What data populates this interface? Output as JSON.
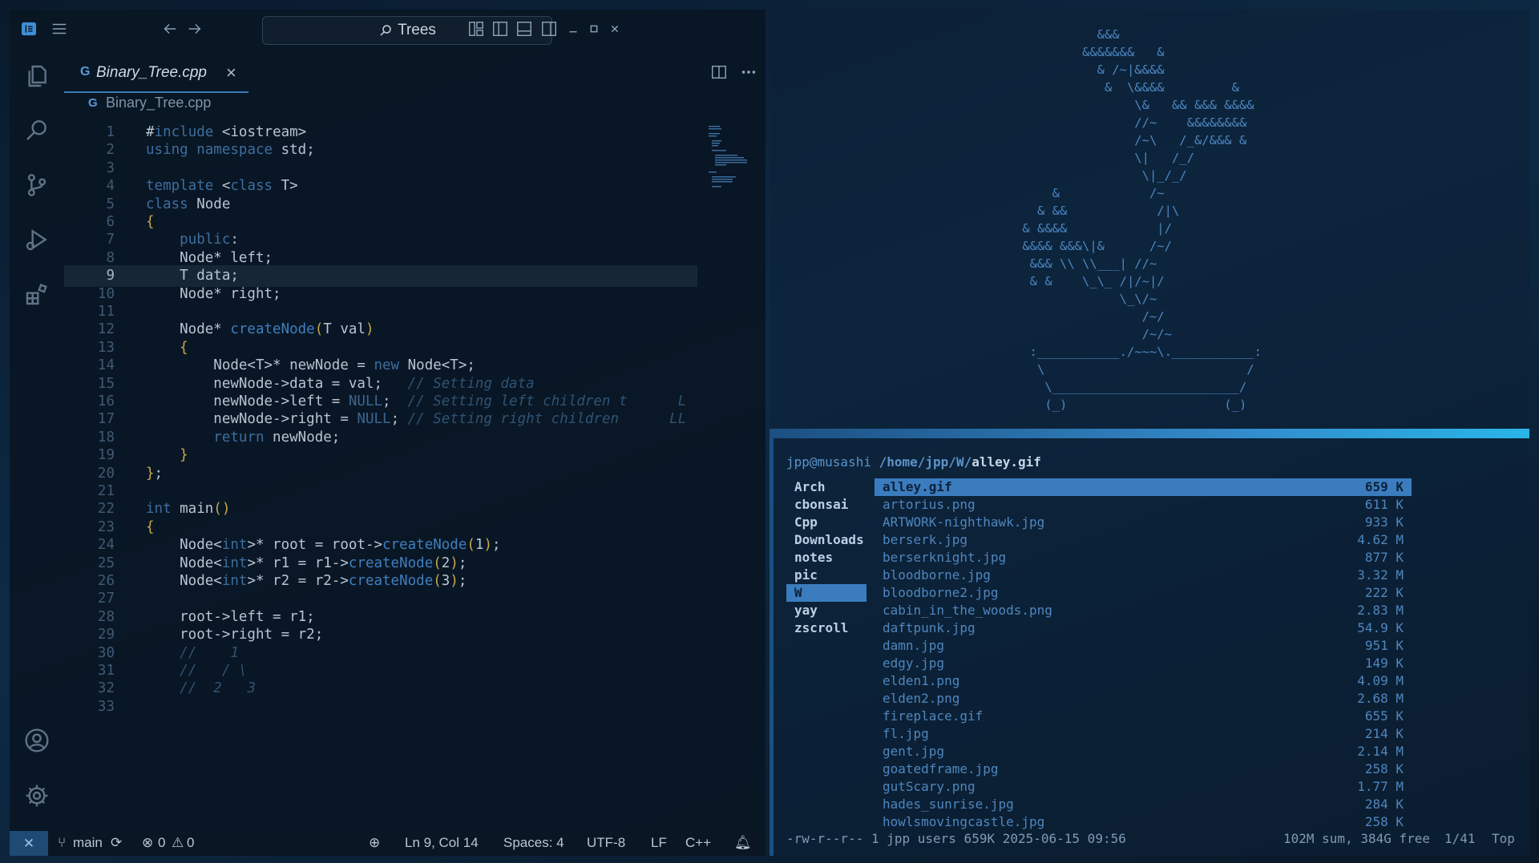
{
  "titlebar": {
    "search_label": "Trees"
  },
  "tab": {
    "label": "Binary_Tree.cpp",
    "close": "×"
  },
  "breadcrumb": {
    "file": "Binary_Tree.cpp"
  },
  "code_lines": [
    {
      "n": "1",
      "code": "#include <iostream>"
    },
    {
      "n": "2",
      "code": "using namespace std;"
    },
    {
      "n": "3",
      "code": ""
    },
    {
      "n": "4",
      "code": "template <class T>"
    },
    {
      "n": "5",
      "code": "class Node"
    },
    {
      "n": "6",
      "code": "{"
    },
    {
      "n": "7",
      "code": "    public:"
    },
    {
      "n": "8",
      "code": "    Node* left;"
    },
    {
      "n": "9",
      "code": "    T data;"
    },
    {
      "n": "10",
      "code": "    Node* right;"
    },
    {
      "n": "11",
      "code": ""
    },
    {
      "n": "12",
      "code": "    Node* createNode(T val)"
    },
    {
      "n": "13",
      "code": "    {"
    },
    {
      "n": "14",
      "code": "        Node<T>* newNode = new Node<T>;"
    },
    {
      "n": "15",
      "code": "        newNode->data = val;   // Setting data"
    },
    {
      "n": "16",
      "code": "        newNode->left = NULL;  // Setting left children t      L"
    },
    {
      "n": "17",
      "code": "        newNode->right = NULL; // Setting right children      LL"
    },
    {
      "n": "18",
      "code": "        return newNode;"
    },
    {
      "n": "19",
      "code": "    }"
    },
    {
      "n": "20",
      "code": "};"
    },
    {
      "n": "21",
      "code": ""
    },
    {
      "n": "22",
      "code": "int main()"
    },
    {
      "n": "23",
      "code": "{"
    },
    {
      "n": "24",
      "code": "    Node<int>* root = root->createNode(1);"
    },
    {
      "n": "25",
      "code": "    Node<int>* r1 = r1->createNode(2);"
    },
    {
      "n": "26",
      "code": "    Node<int>* r2 = r2->createNode(3);"
    },
    {
      "n": "27",
      "code": ""
    },
    {
      "n": "28",
      "code": "    root->left = r1;"
    },
    {
      "n": "29",
      "code": "    root->right = r2;"
    },
    {
      "n": "30",
      "code": "    //    1"
    },
    {
      "n": "31",
      "code": "    //   / \\"
    },
    {
      "n": "32",
      "code": "    //  2   3"
    },
    {
      "n": "33",
      "code": ""
    }
  ],
  "statusbar": {
    "remote": "✕",
    "branch": "main",
    "errors": "0",
    "warnings": "0",
    "position": "Ln 9, Col 14",
    "spaces": "Spaces: 4",
    "encoding": "UTF-8",
    "eol": "LF",
    "language": "C++"
  },
  "terminal": {
    "ascii_art": "              &&&\n            &&&&&&&   &\n              & /~|&&&&\n               &  \\&&&&         &\n                   \\&   && &&& &&&&\n                   //~    &&&&&&&&\n                   /~\\   /_&/&&& &\n                   \\|   /_/\n                    \\|_/_/\n        &            /~\n      & &&            /|\\\n    & &&&&            |/\n    &&&& &&&\\|&      /~/\n     &&& \\\\ \\\\___| //~\n     & &    \\_\\_ /|/~|/\n                 \\_\\/~\n                    /~/\n                    /~/~\n     :___________./~~~\\.___________:\n      \\                           /\n       \\_________________________/\n       (_)                     (_)",
    "prompt_user": "jpp@musashi",
    "prompt_path": "/home/jpp/W/",
    "prompt_file": "alley.gif",
    "dirs": [
      "Arch",
      "cbonsai",
      "Cpp",
      "Downloads",
      "notes",
      "pic",
      "W",
      "yay",
      "zscroll"
    ],
    "selected_dir": "W",
    "files": [
      {
        "name": "alley.gif",
        "size": "659 K"
      },
      {
        "name": "artorius.png",
        "size": "611 K"
      },
      {
        "name": "ARTWORK-nighthawk.jpg",
        "size": "933 K"
      },
      {
        "name": "berserk.jpg",
        "size": "4.62 M"
      },
      {
        "name": "berserknight.jpg",
        "size": "877 K"
      },
      {
        "name": "bloodborne.jpg",
        "size": "3.32 M"
      },
      {
        "name": "bloodborne2.jpg",
        "size": "222 K"
      },
      {
        "name": "cabin_in_the_woods.png",
        "size": "2.83 M"
      },
      {
        "name": "daftpunk.jpg",
        "size": "54.9 K"
      },
      {
        "name": "damn.jpg",
        "size": "951 K"
      },
      {
        "name": "edgy.jpg",
        "size": "149 K"
      },
      {
        "name": "elden1.png",
        "size": "4.09 M"
      },
      {
        "name": "elden2.png",
        "size": "2.68 M"
      },
      {
        "name": "fireplace.gif",
        "size": "655 K"
      },
      {
        "name": "fl.jpg",
        "size": "214 K"
      },
      {
        "name": "gent.jpg",
        "size": "2.14 M"
      },
      {
        "name": "goatedframe.jpg",
        "size": "258 K"
      },
      {
        "name": "gutScary.png",
        "size": "1.77 M"
      },
      {
        "name": "hades_sunrise.jpg",
        "size": "284 K"
      },
      {
        "name": "howlsmovingcastle.jpg",
        "size": "258 K"
      }
    ],
    "status_left": "-rw-r--r-- 1 jpp users 659K 2025-06-15 09:56",
    "status_sum": "102M sum, 384G free",
    "status_pos": "1/41",
    "status_top": "Top"
  },
  "colors": {
    "accent": "#3b7cbf",
    "keyword": "#3d6e9e",
    "comment": "#2f5373",
    "bracket": "#c9a94c"
  }
}
